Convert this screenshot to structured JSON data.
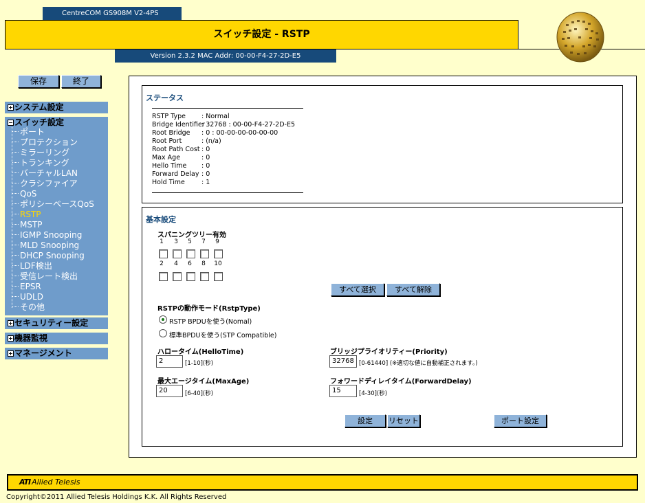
{
  "header": {
    "model": "CentreCOM GS908M V2-4PS",
    "title": "スイッチ設定 - RSTP",
    "version": "Version 2.3.2 MAC Addr: 00-00-F4-27-2D-E5"
  },
  "sidebar": {
    "save_label": "保存",
    "end_label": "終了",
    "sections": [
      "システム設定",
      "スイッチ設定",
      "セキュリティー設定",
      "機器監視",
      "マネージメント"
    ],
    "section_markers": [
      "+",
      "−",
      "+",
      "+",
      "+"
    ],
    "items": [
      "ポート",
      "プロテクション",
      "ミラーリング",
      "トランキング",
      "バーチャルLAN",
      "クラシファイア",
      "QoS",
      "ポリシーベースQoS",
      "RSTP",
      "MSTP",
      "IGMP Snooping",
      "MLD Snooping",
      "DHCP Snooping",
      "LDF検出",
      "受信レート検出",
      "EPSR",
      "UDLD",
      "その他"
    ],
    "active_item": "RSTP"
  },
  "status": {
    "title": "ステータス",
    "rows": [
      {
        "key": "RSTP Type",
        "value": ": Normal"
      },
      {
        "key": "Bridge Identifier",
        "value": ": 32768 : 00-00-F4-27-2D-E5"
      },
      {
        "key": "Root Bridge",
        "value": ": 0 : 00-00-00-00-00-00"
      },
      {
        "key": "Root Port",
        "value": ": (n/a)"
      },
      {
        "key": "Root Path Cost",
        "value": ": 0"
      },
      {
        "key": "Max Age",
        "value": ": 0"
      },
      {
        "key": "Hello Time",
        "value": ": 0"
      },
      {
        "key": "Forward Delay",
        "value": ": 0"
      },
      {
        "key": "Hold Time",
        "value": ": 1"
      }
    ]
  },
  "settings": {
    "title": "基本設定",
    "spanning_label": "スパニングツリー有効",
    "ports_odd": [
      "1",
      "3",
      "5",
      "7",
      "9"
    ],
    "ports_even": [
      "2",
      "4",
      "6",
      "8",
      "10"
    ],
    "select_all": "すべて選択",
    "deselect_all": "すべて解除",
    "mode_label": "RSTPの動作モード(RstpType)",
    "mode_normal": "RSTP BPDUを使う(Nomal)",
    "mode_stp": "標準BPDUを使う(STP Compatible)",
    "hello_label": "ハロータイム(HelloTime)",
    "hello_value": "2",
    "hello_hint": "[1-10](秒)",
    "priority_label": "ブリッジプライオリティー(Priority)",
    "priority_value": "32768",
    "priority_hint": "[0-61440] (※適切な値に自動補正されます。)",
    "maxage_label": "最大エージタイム(MaxAge)",
    "maxage_value": "20",
    "maxage_hint": "[6-40](秒)",
    "fwd_label": "フォワードディレイタイム(ForwardDelay)",
    "fwd_value": "15",
    "fwd_hint": "[4-30](秒)",
    "apply_label": "設定",
    "reset_label": "リセット",
    "port_settings_label": "ポート設定"
  },
  "footer": {
    "logo_mark": "ATI",
    "logo_text": "Allied Telesis",
    "copyright": "Copyright©2011 Allied Telesis Holdings K.K. All Rights Reserved"
  },
  "colors": {
    "background": "#ffffcc",
    "header_gold": "#ffd700",
    "navy": "#174a7a",
    "menu_blue": "#6f9ccb",
    "button_blue": "#8fb3d9"
  }
}
